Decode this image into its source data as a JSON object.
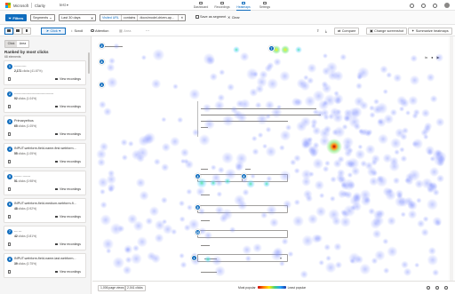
{
  "app": {
    "brand": "Microsoft",
    "product": "Clarity",
    "project": "test",
    "nav_tabs": [
      {
        "label": "Dashboard",
        "active": false
      },
      {
        "label": "Recordings",
        "active": false
      },
      {
        "label": "Heatmaps",
        "active": true
      },
      {
        "label": "Settings",
        "active": false
      }
    ]
  },
  "filterbar": {
    "filters_label": "Filters",
    "segments_label": "Segments",
    "date_range": "Last 30 days",
    "url_filter_label": "Visited URL",
    "url_operator": "contains",
    "url_value": "/docs/model-driven-ap...",
    "save_segment": "Save as segment",
    "clear": "Clear"
  },
  "toolbar": {
    "click_label": "Click",
    "scroll_label": "Scroll",
    "attention_label": "Attention",
    "area_label": "Area",
    "compare_label": "Compare",
    "change_screenshot_label": "Change screenshot",
    "summarize_label": "Summarize heatmaps"
  },
  "sidebar": {
    "tabs": [
      "Click",
      "Area"
    ],
    "title": "Ranked by most clicks",
    "subtitle": "68 elements",
    "view_recordings_label": "View recordings",
    "items": [
      {
        "rank": "1",
        "title": "-----------",
        "clicks": "2,171",
        "pct": "(41.67%)"
      },
      {
        "rank": "2",
        "title": "------------------------------------",
        "clicks": "92",
        "pct": "(1.04%)"
      },
      {
        "rank": "3",
        "title": "Primaryethos",
        "clicks": "65",
        "pct": "(1.05%)"
      },
      {
        "rank": "4",
        "title": "INPUT.webform-field-name-first.webform...",
        "clicks": "55",
        "pct": "(1.05%)"
      },
      {
        "rank": "5",
        "title": "------- -------",
        "clicks": "51",
        "pct": "(0.98%)"
      },
      {
        "rank": "6",
        "title": "INPUT.webform-field-medium-webform-fi...",
        "clicks": "48",
        "pct": "(0.92%)"
      },
      {
        "rank": "7",
        "title": "--- ---",
        "clicks": "42",
        "pct": "(0.81%)"
      },
      {
        "rank": "8",
        "title": "INPUT.webform-field-name-last.webform...",
        "clicks": "39",
        "pct": "(0.75%)"
      }
    ]
  },
  "canvas": {
    "pins": [
      "1",
      "2",
      "3",
      "4",
      "5",
      "6",
      "7",
      "8",
      "10"
    ]
  },
  "bottombar": {
    "page_views": "1,006 page views",
    "clicks": "2,041 clicks",
    "most_popular": "Most popular",
    "least_popular": "Least popular"
  },
  "colors": {
    "accent": "#0f6cbd",
    "hot": "#cc0000",
    "cold": "#1a3aa6"
  }
}
